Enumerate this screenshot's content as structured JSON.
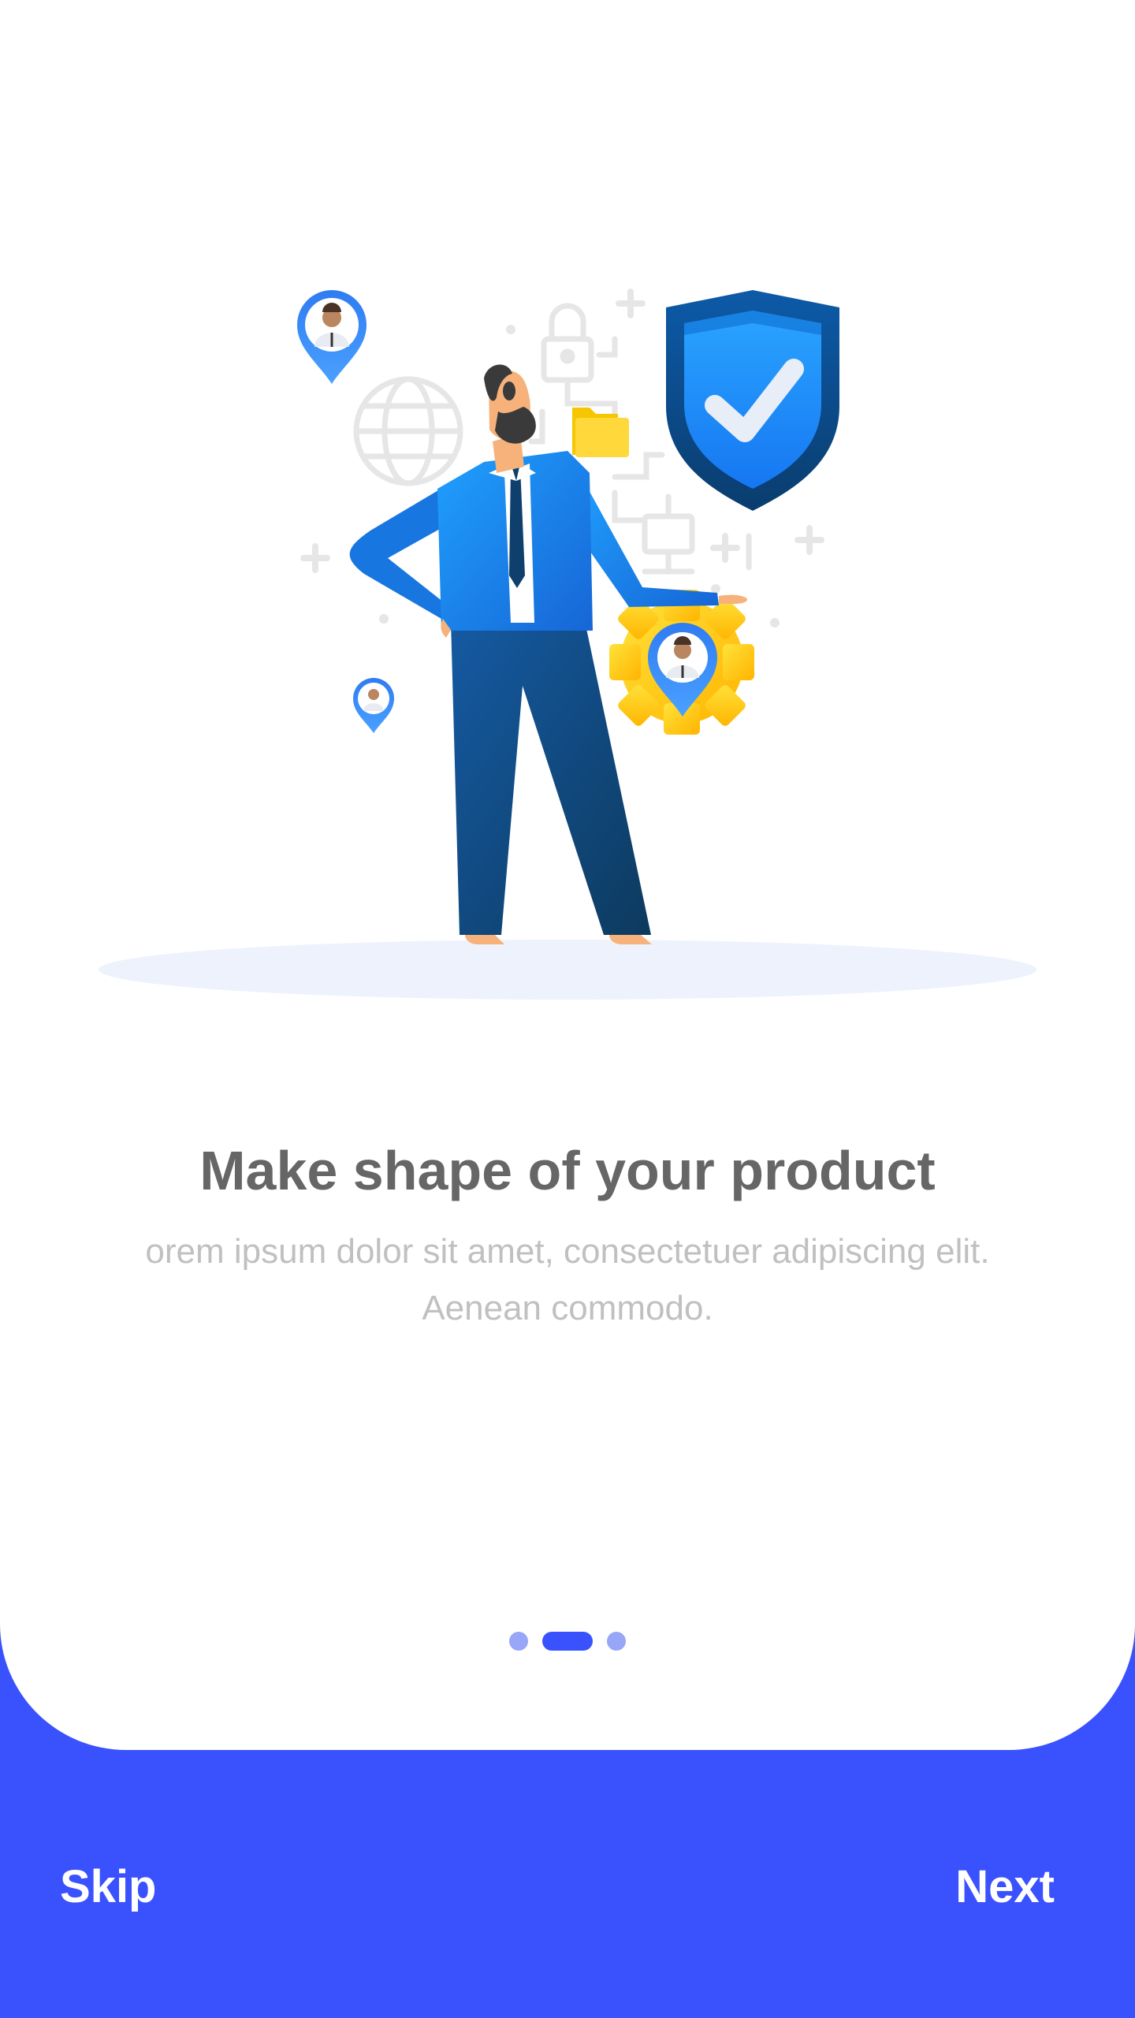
{
  "onboarding": {
    "title": "Make shape of your product",
    "description": "orem ipsum dolor sit amet, consectetuer adipiscing elit. Aenean commodo.",
    "pager": {
      "total": 3,
      "active_index": 1
    }
  },
  "actions": {
    "skip_label": "Skip",
    "next_label": "Next"
  },
  "colors": {
    "primary": "#3a52fd",
    "title_text": "#666666",
    "body_text": "#c0c0c0",
    "dot_inactive": "#97a6f6",
    "shield_blue": "#1e93ff",
    "gear_yellow": "#ffcb14"
  },
  "illustration": {
    "icons": [
      "globe-icon",
      "lock-icon",
      "folder-icon",
      "shield-check-icon",
      "gear-icon",
      "location-pin-icon",
      "network-icon"
    ]
  }
}
